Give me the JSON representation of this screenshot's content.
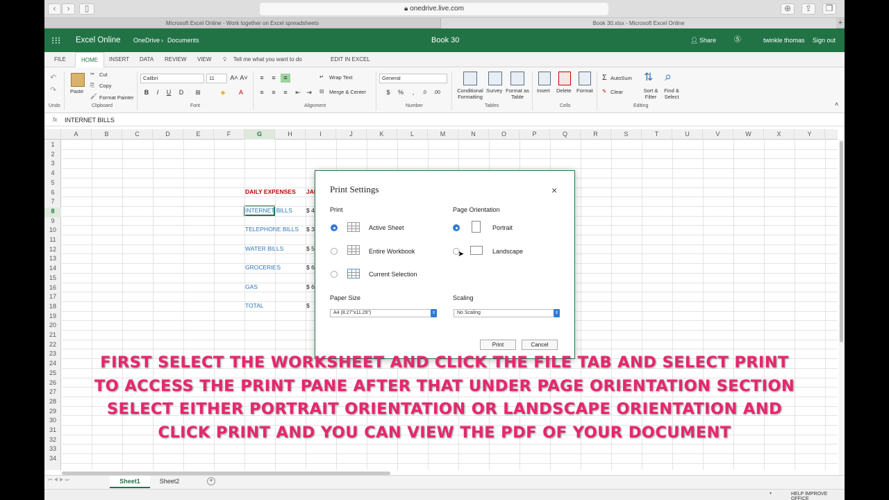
{
  "browser": {
    "url": "onedrive.live.com",
    "tabs": [
      "Microsoft Excel Online - Work together on Excel spreadsheets",
      "Book 30.xlsx - Microsoft Excel Online"
    ]
  },
  "header": {
    "app": "Excel Online",
    "breadcrumb_1": "OneDrive",
    "breadcrumb_sep": "›",
    "breadcrumb_2": "Documents",
    "title": "Book 30",
    "share": "Share",
    "user": "twinkle thomas",
    "signout": "Sign out"
  },
  "ribbon_tabs": [
    "FILE",
    "HOME",
    "INSERT",
    "DATA",
    "REVIEW",
    "VIEW",
    "Tell me what you want to do",
    "EDIT IN EXCEL"
  ],
  "ribbon": {
    "undo": "Undo",
    "paste": "Paste",
    "cut": "Cut",
    "copy": "Copy",
    "format_painter": "Format Painter",
    "clipboard": "Clipboard",
    "font_name": "Calibri",
    "font_size": "11",
    "font": "Font",
    "bold": "B",
    "italic": "I",
    "underline": "U",
    "wrap_text": "Wrap Text",
    "merge_center": "Merge & Center",
    "alignment": "Alignment",
    "number_format": "General",
    "currency": "$",
    "percent": "%",
    "number": "Number",
    "conditional": "Conditional Formatting",
    "survey": "Survey",
    "format_table": "Format as Table",
    "tables": "Tables",
    "insert": "Insert",
    "delete": "Delete",
    "format": "Format",
    "cells": "Cells",
    "autosum": "AutoSum",
    "clear": "Clear",
    "sort_filter": "Sort & Filter",
    "find_select": "Find & Select",
    "editing": "Editing"
  },
  "formula_bar": {
    "fx": "fx",
    "content": "INTERNET BILLS"
  },
  "columns": [
    "A",
    "B",
    "C",
    "D",
    "E",
    "F",
    "G",
    "H",
    "I",
    "J",
    "K",
    "L",
    "M",
    "N",
    "O",
    "P",
    "Q",
    "R",
    "S",
    "T",
    "U",
    "V",
    "W",
    "X",
    "Y"
  ],
  "rows": [
    "1",
    "2",
    "3",
    "4",
    "5",
    "6",
    "7",
    "8",
    "9",
    "10",
    "11",
    "12",
    "13",
    "14",
    "15",
    "16",
    "17",
    "18",
    "19",
    "20",
    "21",
    "22",
    "23",
    "24",
    "25",
    "26",
    "27",
    "28",
    "29",
    "30",
    "31",
    "32",
    "33",
    "34"
  ],
  "sheet_cells": {
    "g6": "DAILY EXPENSES",
    "i6": "JAN",
    "g8": "INTERNET BILLS",
    "i8": "$ 4",
    "g10": "TELEPHONE BILLS",
    "i10": "$ 3",
    "g12": "WATER BILLS",
    "i12": "$ 5",
    "g14": "GROCERIES",
    "i14": "$ 6",
    "g16": "GAS",
    "i16": "$ 6",
    "g18": "TOTAL",
    "i18": "$"
  },
  "sheets": [
    "Sheet1",
    "Sheet2"
  ],
  "status": "HELP IMPROVE OFFICE",
  "dialog": {
    "title": "Print Settings",
    "close": "×",
    "print_label": "Print",
    "print_options": [
      "Active Sheet",
      "Entire Workbook",
      "Current Selection"
    ],
    "orientation_label": "Page Orientation",
    "orientation_options": [
      "Portrait",
      "Landscape"
    ],
    "paper_label": "Paper Size",
    "paper_value": "A4 (8.27\"x11.29\")",
    "scaling_label": "Scaling",
    "scaling_value": "No Scaling",
    "print_button": "Print",
    "cancel_button": "Cancel"
  },
  "caption": {
    "line1": "FIRST SELECT THE WORKSHEET AND  CLICK THE FILE TAB AND SELECT PRINT",
    "line2": "TO ACCESS THE PRINT PANE AFTER THAT UNDER PAGE ORIENTATION SECTION",
    "line3": "SELECT EITHER PORTRAIT ORIENTATION OR LANDSCAPE ORIENTATION  AND",
    "line4": "CLICK PRINT AND YOU CAN VIEW THE PDF OF YOUR DOCUMENT"
  },
  "colors": {
    "excel_green": "#217346",
    "caption_pink": "#e8266e",
    "radio_blue": "#2e7bd6",
    "label_red": "#c00000",
    "cell_blue": "#2e75b6"
  }
}
